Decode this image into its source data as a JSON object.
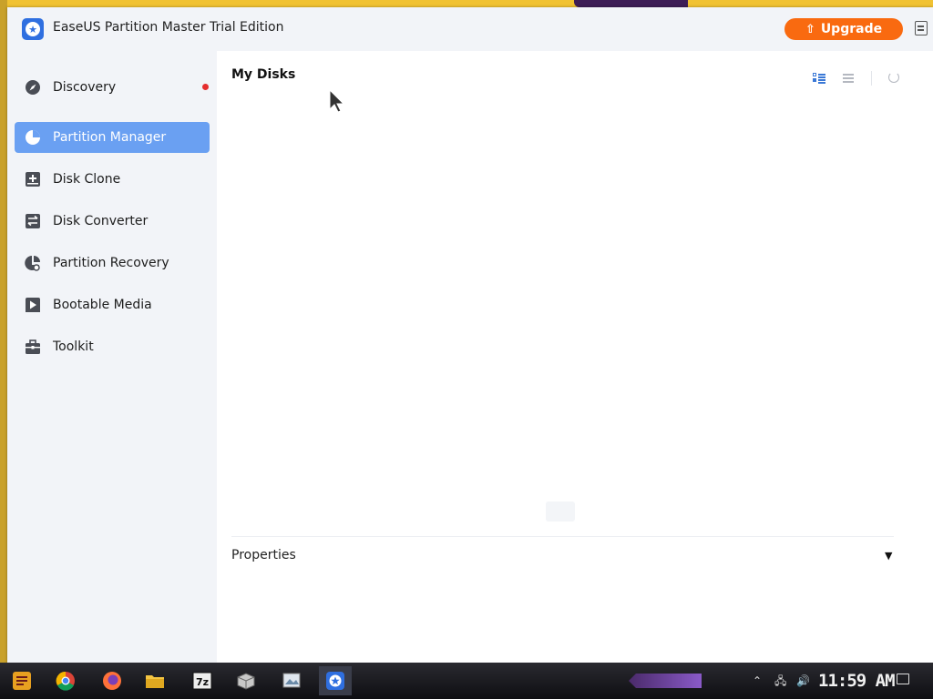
{
  "window": {
    "title": "EaseUS Partition Master Trial Edition",
    "upgrade_label": "Upgrade",
    "upgrade_color": "#f96a10"
  },
  "sidebar": {
    "items": [
      {
        "label": "Discovery",
        "icon": "compass-icon",
        "badge": true
      },
      {
        "label": "Partition Manager",
        "icon": "pie-chart-icon",
        "active": true
      },
      {
        "label": "Disk Clone",
        "icon": "disk-clone-icon"
      },
      {
        "label": "Disk Converter",
        "icon": "disk-converter-icon"
      },
      {
        "label": "Partition Recovery",
        "icon": "partition-recovery-icon"
      },
      {
        "label": "Bootable Media",
        "icon": "bootable-media-icon"
      },
      {
        "label": "Toolkit",
        "icon": "toolbox-icon"
      }
    ],
    "active_color": "#6aa0f2"
  },
  "main": {
    "section_title": "My Disks",
    "properties_label": "Properties",
    "properties_toggle": "▼"
  },
  "taskbar": {
    "apps": [
      "start-menu-icon",
      "chrome-icon",
      "firefox-icon",
      "file-explorer-icon",
      "7zip-icon",
      "package-icon",
      "image-viewer-icon",
      "easeus-partition-master-icon"
    ],
    "clock": "11:59 AM"
  }
}
